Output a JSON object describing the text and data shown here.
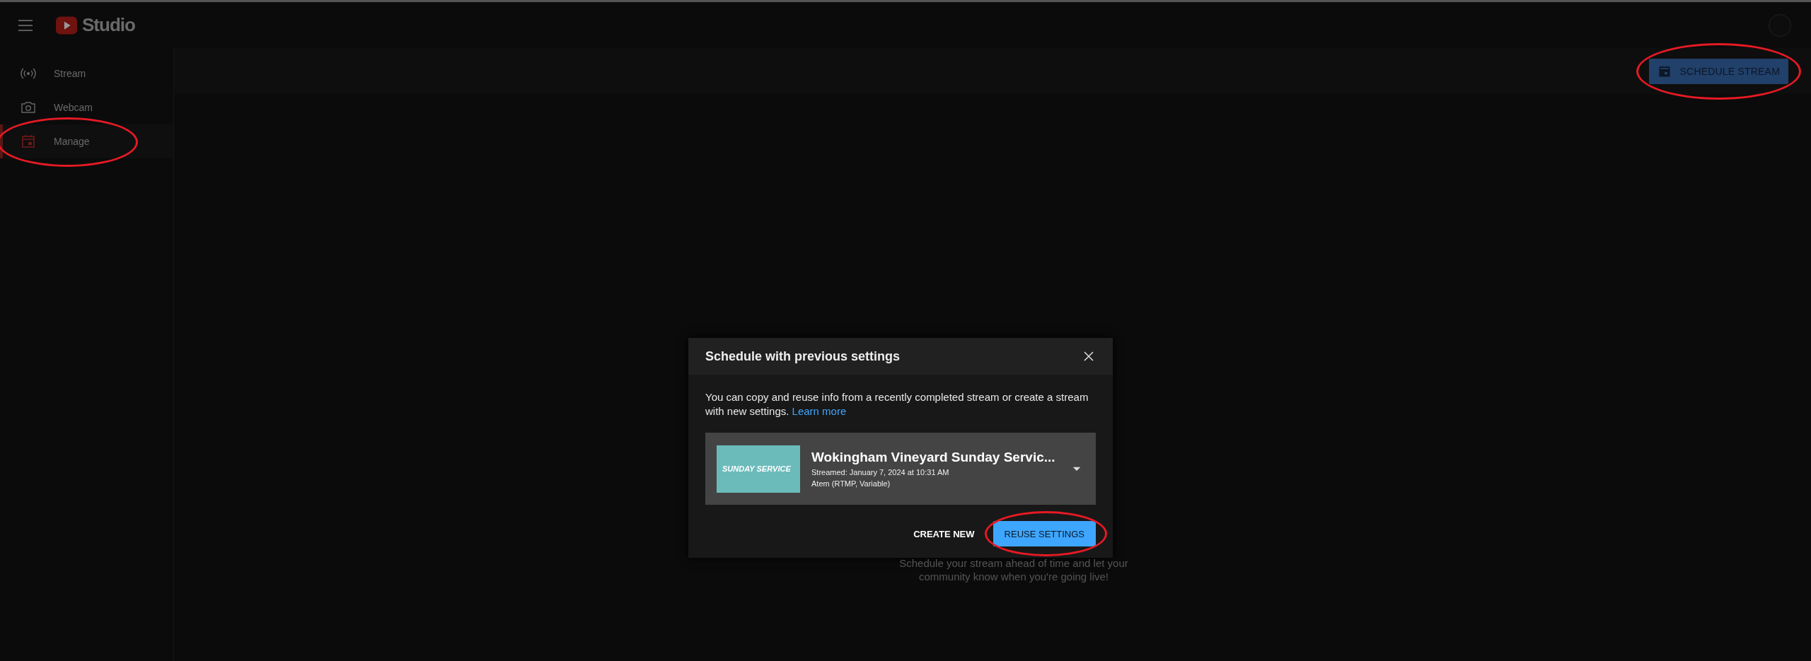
{
  "header": {
    "logo_text": "Studio"
  },
  "sidebar": {
    "items": [
      {
        "kind": "stream",
        "label": "Stream",
        "selected": false,
        "circled": false
      },
      {
        "kind": "webcam",
        "label": "Webcam",
        "selected": false,
        "circled": false
      },
      {
        "kind": "manage",
        "label": "Manage",
        "selected": true,
        "circled": true
      }
    ]
  },
  "toolbar": {
    "button": {
      "label": "SCHEDULE STREAM",
      "circled": true
    }
  },
  "empty_state": {
    "text": "Schedule your stream ahead of time and let your community know when you're going live!"
  },
  "dialog": {
    "title": "Schedule with previous settings",
    "intro": "You can copy and reuse info from a recently completed stream or create a stream with new settings.",
    "link": "Learn more",
    "stream": {
      "thumbnail_text": "SUNDAY SERVICE",
      "title": "Wokingham Vineyard Sunday Servic...",
      "streamed": "Streamed: January 7, 2024 at 10:31 AM",
      "encoder": "Atem (RTMP, Variable)"
    },
    "buttons": [
      {
        "kind": "text",
        "label": "CREATE NEW",
        "circled": false
      },
      {
        "kind": "primary",
        "label": "REUSE SETTINGS",
        "circled": true
      }
    ]
  }
}
